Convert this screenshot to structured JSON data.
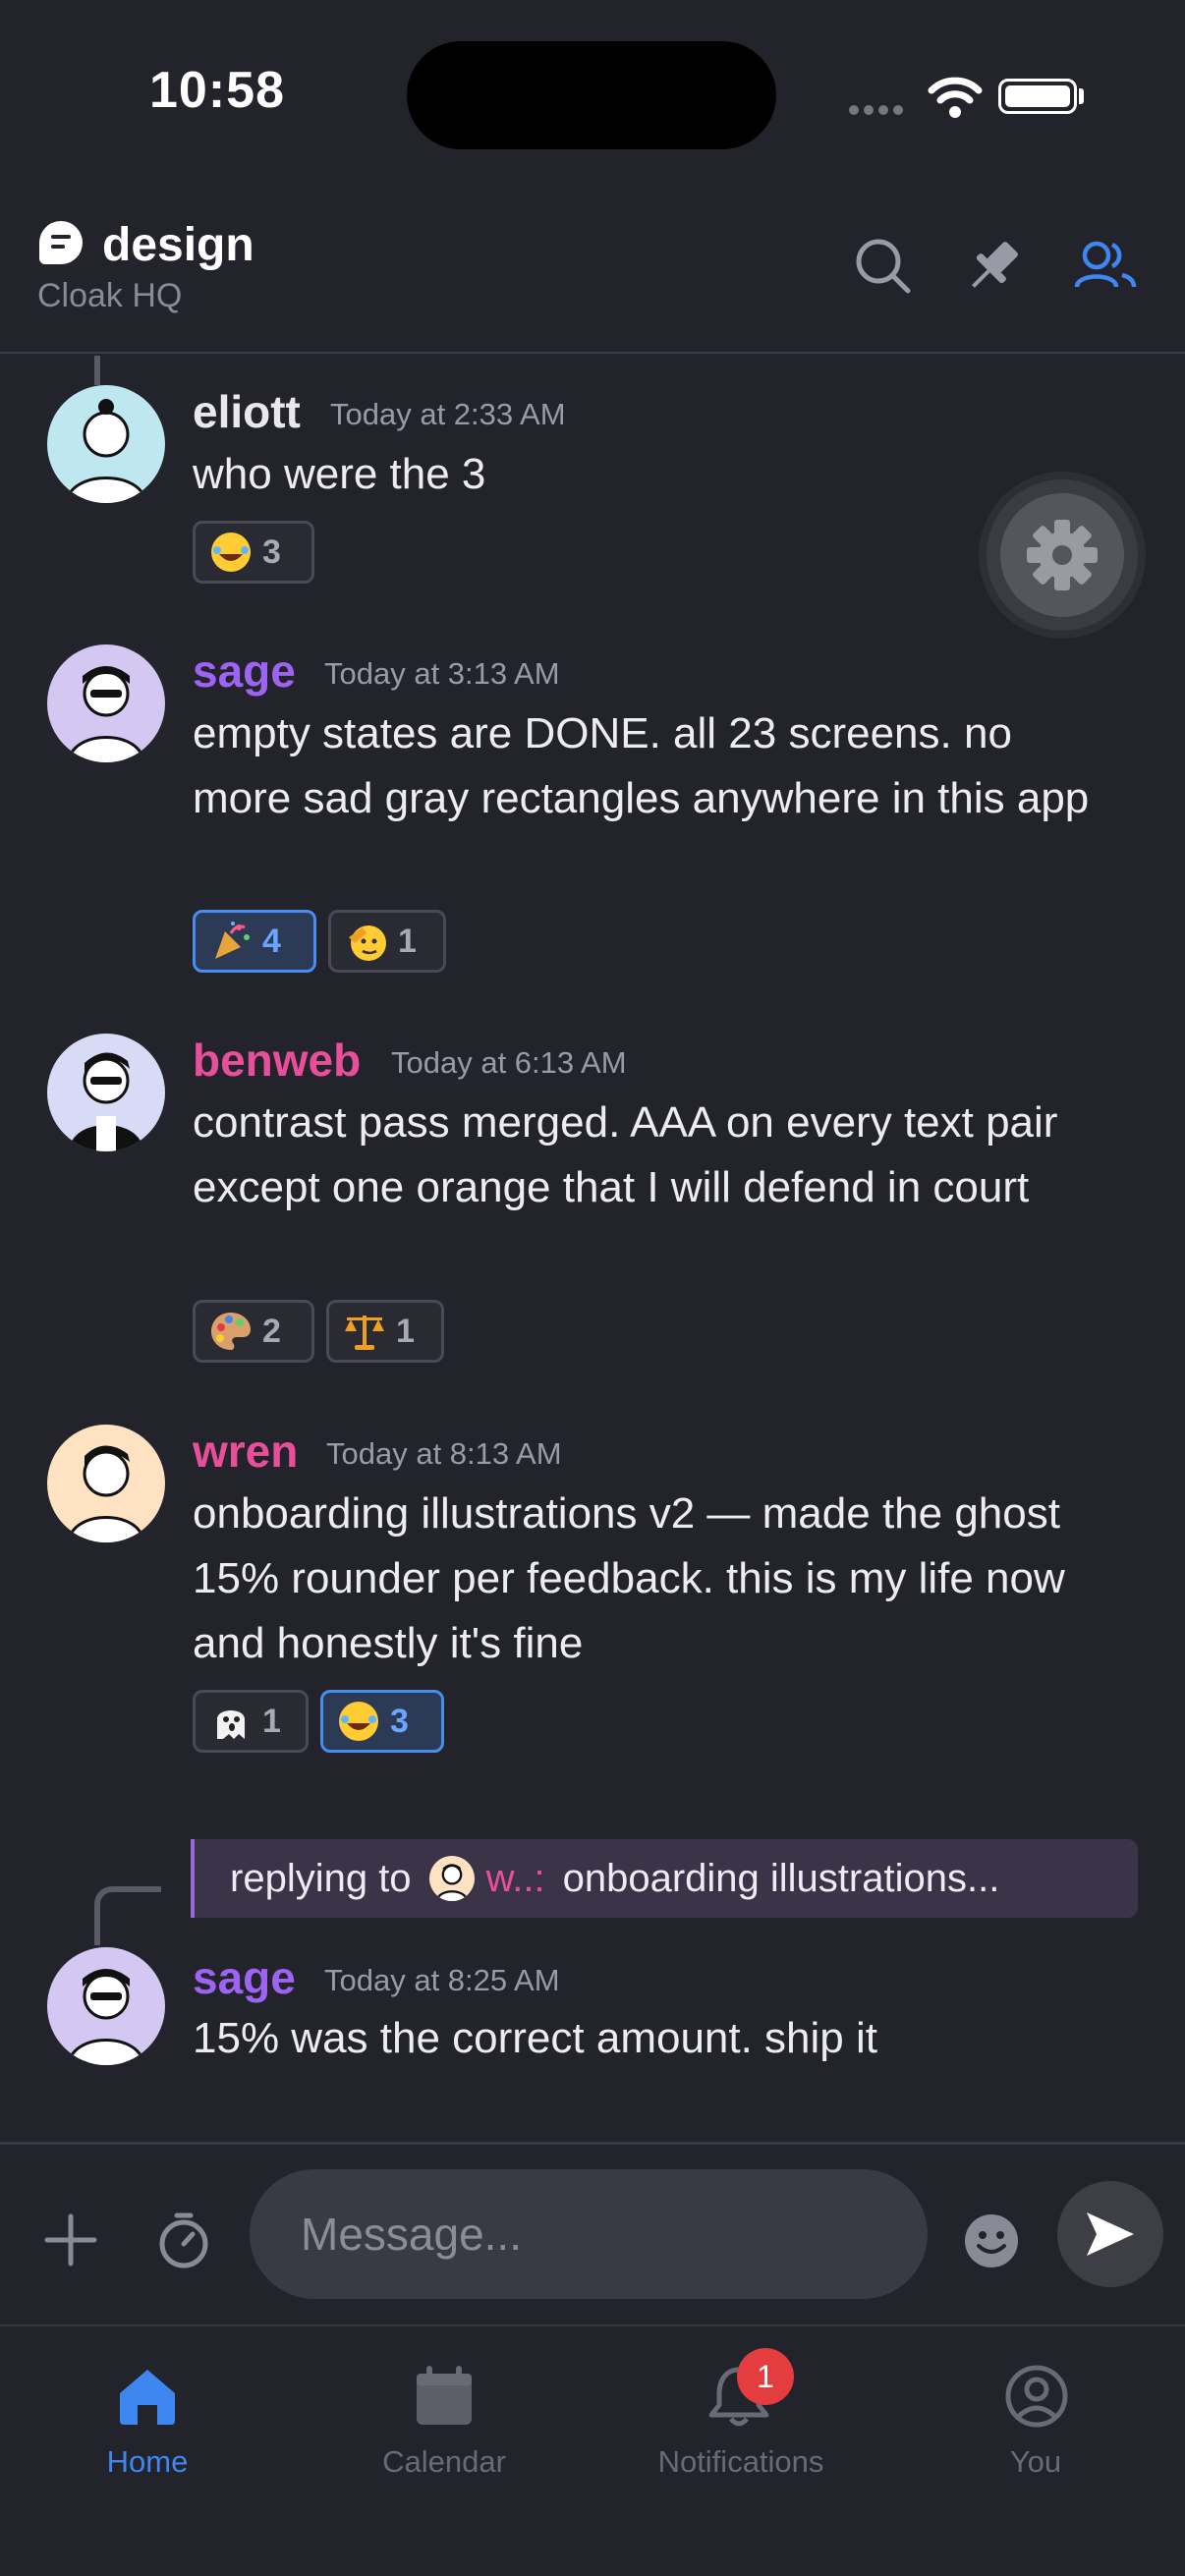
{
  "status_bar": {
    "time": "10:58"
  },
  "header": {
    "channel_name": "design",
    "server_name": "Cloak HQ"
  },
  "colors": {
    "accent": "#3f87f0",
    "background": "#23232b",
    "sage": "#9d63f2",
    "pink": "#e84f9a"
  },
  "messages": [
    {
      "username": "eliott",
      "color": "#ffffff",
      "timestamp": "Today at 2:33 AM",
      "text": "who were the 3",
      "reactions": [
        {
          "emoji": "joy-emoji",
          "count": "3",
          "active": false
        }
      ]
    },
    {
      "username": "sage",
      "color": "#9d63f2",
      "timestamp": "Today at 3:13 AM",
      "text": "empty states are DONE. all 23 screens. no more sad gray rectangles anywhere in this app",
      "reactions": [
        {
          "emoji": "party-popper-emoji",
          "count": "4",
          "active": true
        },
        {
          "emoji": "saluting-face-emoji",
          "count": "1",
          "active": false
        }
      ]
    },
    {
      "username": "benweb",
      "color": "#e84f9a",
      "timestamp": "Today at 6:13 AM",
      "text": "contrast pass merged. AAA on every text pair except one orange that I will defend in court",
      "reactions": [
        {
          "emoji": "palette-emoji",
          "count": "2",
          "active": false
        },
        {
          "emoji": "scales-emoji",
          "count": "1",
          "active": false
        }
      ]
    },
    {
      "username": "wren",
      "color": "#e84f9a",
      "timestamp": "Today at 8:13 AM",
      "text": "onboarding illustrations v2 — made the ghost 15% rounder per feedback. this is my life now and honestly it's fine",
      "reactions": [
        {
          "emoji": "ghost-emoji",
          "count": "1",
          "active": false
        },
        {
          "emoji": "joy-emoji",
          "count": "3",
          "active": true
        }
      ]
    },
    {
      "username": "sage",
      "color": "#9d63f2",
      "timestamp": "Today at 8:25 AM",
      "text": "15% was the correct amount. ship it",
      "reactions": []
    }
  ],
  "reply": {
    "prefix": "replying to",
    "name": "w..:",
    "snippet": "onboarding illustrations..."
  },
  "composer": {
    "placeholder": "Message..."
  },
  "tabs": [
    {
      "label": "Home",
      "active": true
    },
    {
      "label": "Calendar",
      "active": false
    },
    {
      "label": "Notifications",
      "active": false,
      "badge": "1"
    },
    {
      "label": "You",
      "active": false
    }
  ]
}
